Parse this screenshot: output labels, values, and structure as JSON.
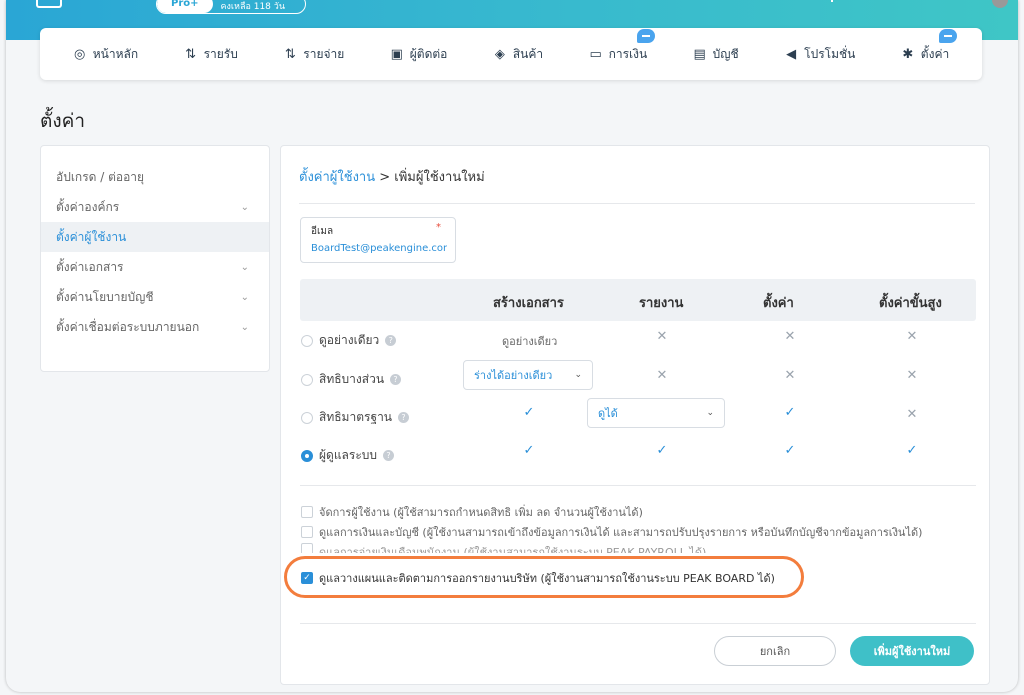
{
  "topbar": {
    "plan": "Pro+",
    "remaining": "คงเหลือ 118 วัน"
  },
  "nav": [
    {
      "label": "หน้าหลัก",
      "icon": "dashboard-icon",
      "glyph": "◎",
      "badge": false
    },
    {
      "label": "รายรับ",
      "icon": "income-icon",
      "glyph": "⇅",
      "badge": false
    },
    {
      "label": "รายจ่าย",
      "icon": "expense-icon",
      "glyph": "⇅",
      "badge": false
    },
    {
      "label": "ผู้ติดต่อ",
      "icon": "contacts-icon",
      "glyph": "▣",
      "badge": false
    },
    {
      "label": "สินค้า",
      "icon": "product-icon",
      "glyph": "◈",
      "badge": false
    },
    {
      "label": "การเงิน",
      "icon": "finance-icon",
      "glyph": "▭",
      "badge": true
    },
    {
      "label": "บัญชี",
      "icon": "accounting-icon",
      "glyph": "▤",
      "badge": false
    },
    {
      "label": "โปรโมชั่น",
      "icon": "promotion-icon",
      "glyph": "◀",
      "badge": false
    },
    {
      "label": "ตั้งค่า",
      "icon": "gear-icon",
      "glyph": "✱",
      "badge": true
    }
  ],
  "page_title": "ตั้งค่า",
  "sidebar": {
    "items": [
      {
        "label": "อัปเกรด / ต่ออายุ",
        "chevron": false,
        "active": false
      },
      {
        "label": "ตั้งค่าองค์กร",
        "chevron": true,
        "active": false
      },
      {
        "label": "ตั้งค่าผู้ใช้งาน",
        "chevron": false,
        "active": true
      },
      {
        "label": "ตั้งค่าเอกสาร",
        "chevron": true,
        "active": false
      },
      {
        "label": "ตั้งค่านโยบายบัญชี",
        "chevron": true,
        "active": false
      },
      {
        "label": "ตั้งค่าเชื่อมต่อระบบภายนอก",
        "chevron": true,
        "active": false
      }
    ]
  },
  "breadcrumb": {
    "link": "ตั้งค่าผู้ใช้งาน",
    "separator": ">",
    "current": "เพิ่มผู้ใช้งานใหม่"
  },
  "email": {
    "label": "อีเมล",
    "required_mark": "*",
    "value": "BoardTest@peakengine.com"
  },
  "permissions": {
    "columns": [
      "สร้างเอกสาร",
      "รายงาน",
      "ตั้งค่า",
      "ตั้งค่าขั้นสูง"
    ],
    "rows": [
      {
        "label": "ดูอย่างเดียว",
        "selected": false
      },
      {
        "label": "สิทธิบางส่วน",
        "selected": false
      },
      {
        "label": "สิทธิมาตรฐาน",
        "selected": false
      },
      {
        "label": "ผู้ดูแลระบบ",
        "selected": true
      }
    ],
    "view_only_text": "ดูอย่างเดียว",
    "partial_select": "ร่างได้อย่างเดียว",
    "standard_select": "ดูได้",
    "cross": "✕",
    "check": "✓"
  },
  "extras": [
    {
      "label": "จัดการผู้ใช้งาน (ผู้ใช้สามารถกำหนดสิทธิ เพิ่ม ลด จำนวนผู้ใช้งานได้)",
      "checked": false
    },
    {
      "label": "ดูแลการเงินและบัญชี (ผู้ใช้งานสามารถเข้าถึงข้อมูลการเงินได้ และสามารถปรับปรุงรายการ หรือบันทึกบัญชีจากข้อมูลการเงินได้)",
      "checked": false
    },
    {
      "label": "ดูแลการจ่ายเงินเดือนพนักงาน (ผู้ใช้งานสามารถใช้งานระบบ PEAK PAYROLL ได้)",
      "checked": false
    },
    {
      "label": "ดูแลวางแผนและติดตามการออกรายงานบริษัท (ผู้ใช้งานสามารถใช้งานระบบ PEAK BOARD ได้)",
      "checked": true
    }
  ],
  "buttons": {
    "cancel": "ยกเลิก",
    "submit": "เพิ่มผู้ใช้งานใหม่"
  },
  "colors": {
    "accent": "#2a8fd8",
    "primary_button": "#3fc0c8",
    "highlight_ring": "#f37d3d"
  }
}
